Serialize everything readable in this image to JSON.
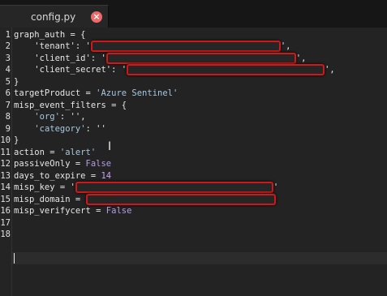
{
  "tab": {
    "title": "config.py",
    "close_glyph": "×"
  },
  "colors": {
    "background": "#232323",
    "string": "#a6c8e0",
    "keyword": "#b89ae8",
    "redaction": "#d01818"
  },
  "lines": [
    {
      "num": "1",
      "text": "graph_auth = {"
    },
    {
      "num": "2",
      "pre": "    'tenant': '",
      "redacted": true,
      "post": "',"
    },
    {
      "num": "3",
      "pre": "    'client_id': '",
      "redacted": true,
      "post": "',"
    },
    {
      "num": "4",
      "pre": "    'client_secret': '",
      "redacted": true,
      "post": "',"
    },
    {
      "num": "5",
      "text": "}"
    },
    {
      "num": "6",
      "pre": "targetProduct = ",
      "str": "'Azure Sentinel'"
    },
    {
      "num": "7",
      "text": "misp_event_filters = {"
    },
    {
      "num": "8",
      "pre": "    ",
      "str": "'org'",
      "post": ": '',"
    },
    {
      "num": "9",
      "pre": "    ",
      "str": "'category'",
      "post": ": ''"
    },
    {
      "num": "10",
      "text": "}"
    },
    {
      "num": "11",
      "pre": "action = ",
      "str": "'alert'"
    },
    {
      "num": "12",
      "pre": "passiveOnly = ",
      "kw": "False"
    },
    {
      "num": "13",
      "pre": "days_to_expire = ",
      "numval": "14"
    },
    {
      "num": "14",
      "pre": "misp_key = '",
      "redacted": true,
      "post": "'"
    },
    {
      "num": "15",
      "pre": "misp_domain = ",
      "redacted": true,
      "post": ""
    },
    {
      "num": "16",
      "pre": "misp_verifycert = ",
      "kw": "False"
    },
    {
      "num": "17",
      "text": ""
    },
    {
      "num": "18",
      "text": ""
    }
  ]
}
